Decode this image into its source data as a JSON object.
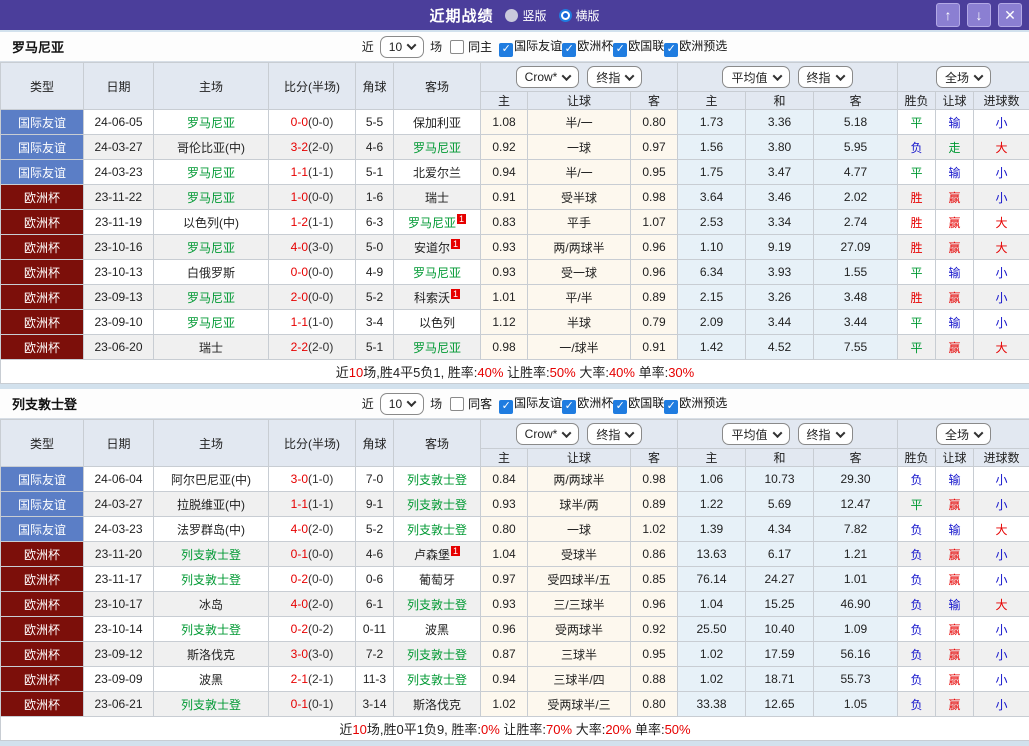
{
  "titlebar": {
    "title": "近期战绩",
    "radios": [
      {
        "label": "竖版",
        "selected": false
      },
      {
        "label": "横版",
        "selected": true
      }
    ],
    "buttons": {
      "up": "↑",
      "down": "↓",
      "close": "✕"
    }
  },
  "table_header": {
    "left_columns": [
      "类型",
      "日期",
      "主场",
      "比分(半场)",
      "角球",
      "客场"
    ],
    "odds_group": {
      "dropdowns": [
        "Crow*",
        "终指"
      ],
      "sub": [
        "主",
        "让球",
        "客"
      ]
    },
    "avg_group": {
      "dropdowns": [
        "平均值",
        "终指"
      ],
      "sub": [
        "主",
        "和",
        "客"
      ]
    },
    "result_group": {
      "dropdowns": [
        "全场"
      ],
      "sub": [
        "胜负",
        "让球",
        "进球数"
      ]
    }
  },
  "result_colors": {
    "胜": "#e60000",
    "平": "#009933",
    "负": "#1414cc",
    "赢": "#e60000",
    "走": "#009933",
    "输": "#1414cc",
    "大": "#e60000",
    "小": "#1414cc"
  },
  "type_colors": {
    "国际友谊": "blue",
    "欧洲杯": "maroon"
  },
  "sections": [
    {
      "team": "罗马尼亚",
      "filter": {
        "near_label": "近",
        "matches_value": "10",
        "unit_label": "场",
        "same_checkbox": {
          "label": "同主",
          "checked": false
        },
        "league_checkboxes": [
          {
            "label": "国际友谊",
            "checked": true
          },
          {
            "label": "欧洲杯",
            "checked": true
          },
          {
            "label": "欧国联",
            "checked": true
          },
          {
            "label": "欧洲预选",
            "checked": true
          }
        ]
      },
      "rows": [
        {
          "type": "国际友谊",
          "date": "24-06-05",
          "home": "罗马尼亚",
          "home_green": true,
          "home_mark": "",
          "score": "0-0",
          "half": "(0-0)",
          "corner": "5-5",
          "away": "保加利亚",
          "away_green": false,
          "away_mark": "",
          "odds": [
            "1.08",
            "半/一",
            "0.80"
          ],
          "avg": [
            "1.73",
            "3.36",
            "5.18"
          ],
          "result": [
            "平",
            "输",
            "小"
          ]
        },
        {
          "type": "国际友谊",
          "date": "24-03-27",
          "home": "哥伦比亚(中)",
          "home_green": false,
          "home_mark": "",
          "score": "3-2",
          "half": "(2-0)",
          "corner": "4-6",
          "away": "罗马尼亚",
          "away_green": true,
          "away_mark": "",
          "odds": [
            "0.92",
            "一球",
            "0.97"
          ],
          "avg": [
            "1.56",
            "3.80",
            "5.95"
          ],
          "result": [
            "负",
            "走",
            "大"
          ]
        },
        {
          "type": "国际友谊",
          "date": "24-03-23",
          "home": "罗马尼亚",
          "home_green": true,
          "home_mark": "",
          "score": "1-1",
          "half": "(1-1)",
          "corner": "5-1",
          "away": "北爱尔兰",
          "away_green": false,
          "away_mark": "",
          "odds": [
            "0.94",
            "半/一",
            "0.95"
          ],
          "avg": [
            "1.75",
            "3.47",
            "4.77"
          ],
          "result": [
            "平",
            "输",
            "小"
          ]
        },
        {
          "type": "欧洲杯",
          "date": "23-11-22",
          "home": "罗马尼亚",
          "home_green": true,
          "home_mark": "",
          "score": "1-0",
          "half": "(0-0)",
          "corner": "1-6",
          "away": "瑞士",
          "away_green": false,
          "away_mark": "",
          "odds": [
            "0.91",
            "受半球",
            "0.98"
          ],
          "avg": [
            "3.64",
            "3.46",
            "2.02"
          ],
          "result": [
            "胜",
            "赢",
            "小"
          ]
        },
        {
          "type": "欧洲杯",
          "date": "23-11-19",
          "home": "以色列(中)",
          "home_green": false,
          "home_mark": "",
          "score": "1-2",
          "half": "(1-1)",
          "corner": "6-3",
          "away": "罗马尼亚",
          "away_green": true,
          "away_mark": "1",
          "odds": [
            "0.83",
            "平手",
            "1.07"
          ],
          "avg": [
            "2.53",
            "3.34",
            "2.74"
          ],
          "result": [
            "胜",
            "赢",
            "大"
          ]
        },
        {
          "type": "欧洲杯",
          "date": "23-10-16",
          "home": "罗马尼亚",
          "home_green": true,
          "home_mark": "",
          "score": "4-0",
          "half": "(3-0)",
          "corner": "5-0",
          "away": "安道尔",
          "away_green": false,
          "away_mark": "1",
          "odds": [
            "0.93",
            "两/两球半",
            "0.96"
          ],
          "avg": [
            "1.10",
            "9.19",
            "27.09"
          ],
          "result": [
            "胜",
            "赢",
            "大"
          ]
        },
        {
          "type": "欧洲杯",
          "date": "23-10-13",
          "home": "白俄罗斯",
          "home_green": false,
          "home_mark": "",
          "score": "0-0",
          "half": "(0-0)",
          "corner": "4-9",
          "away": "罗马尼亚",
          "away_green": true,
          "away_mark": "",
          "odds": [
            "0.93",
            "受一球",
            "0.96"
          ],
          "avg": [
            "6.34",
            "3.93",
            "1.55"
          ],
          "result": [
            "平",
            "输",
            "小"
          ]
        },
        {
          "type": "欧洲杯",
          "date": "23-09-13",
          "home": "罗马尼亚",
          "home_green": true,
          "home_mark": "",
          "score": "2-0",
          "half": "(0-0)",
          "corner": "5-2",
          "away": "科索沃",
          "away_green": false,
          "away_mark": "1",
          "odds": [
            "1.01",
            "平/半",
            "0.89"
          ],
          "avg": [
            "2.15",
            "3.26",
            "3.48"
          ],
          "result": [
            "胜",
            "赢",
            "小"
          ]
        },
        {
          "type": "欧洲杯",
          "date": "23-09-10",
          "home": "罗马尼亚",
          "home_green": true,
          "home_mark": "",
          "score": "1-1",
          "half": "(1-0)",
          "corner": "3-4",
          "away": "以色列",
          "away_green": false,
          "away_mark": "",
          "odds": [
            "1.12",
            "半球",
            "0.79"
          ],
          "avg": [
            "2.09",
            "3.44",
            "3.44"
          ],
          "result": [
            "平",
            "输",
            "小"
          ]
        },
        {
          "type": "欧洲杯",
          "date": "23-06-20",
          "home": "瑞士",
          "home_green": false,
          "home_mark": "",
          "score": "2-2",
          "half": "(2-0)",
          "corner": "5-1",
          "away": "罗马尼亚",
          "away_green": true,
          "away_mark": "",
          "odds": [
            "0.98",
            "一/球半",
            "0.91"
          ],
          "avg": [
            "1.42",
            "4.52",
            "7.55"
          ],
          "result": [
            "平",
            "赢",
            "大"
          ]
        }
      ],
      "summary": [
        {
          "t": "近"
        },
        {
          "t": "10",
          "red": true
        },
        {
          "t": "场,胜4平5负1, 胜率:"
        },
        {
          "t": "40%",
          "red": true
        },
        {
          "t": " 让胜率:"
        },
        {
          "t": "50%",
          "red": true
        },
        {
          "t": " 大率:"
        },
        {
          "t": "40%",
          "red": true
        },
        {
          "t": " 单率:"
        },
        {
          "t": "30%",
          "red": true
        }
      ]
    },
    {
      "team": "列支敦士登",
      "filter": {
        "near_label": "近",
        "matches_value": "10",
        "unit_label": "场",
        "same_checkbox": {
          "label": "同客",
          "checked": false
        },
        "league_checkboxes": [
          {
            "label": "国际友谊",
            "checked": true
          },
          {
            "label": "欧洲杯",
            "checked": true
          },
          {
            "label": "欧国联",
            "checked": true
          },
          {
            "label": "欧洲预选",
            "checked": true
          }
        ]
      },
      "rows": [
        {
          "type": "国际友谊",
          "date": "24-06-04",
          "home": "阿尔巴尼亚(中)",
          "home_green": false,
          "home_mark": "",
          "score": "3-0",
          "half": "(1-0)",
          "corner": "7-0",
          "away": "列支敦士登",
          "away_green": true,
          "away_mark": "",
          "odds": [
            "0.84",
            "两/两球半",
            "0.98"
          ],
          "avg": [
            "1.06",
            "10.73",
            "29.30"
          ],
          "result": [
            "负",
            "输",
            "小"
          ]
        },
        {
          "type": "国际友谊",
          "date": "24-03-27",
          "home": "拉脱维亚(中)",
          "home_green": false,
          "home_mark": "",
          "score": "1-1",
          "half": "(1-1)",
          "corner": "9-1",
          "away": "列支敦士登",
          "away_green": true,
          "away_mark": "",
          "odds": [
            "0.93",
            "球半/两",
            "0.89"
          ],
          "avg": [
            "1.22",
            "5.69",
            "12.47"
          ],
          "result": [
            "平",
            "赢",
            "小"
          ]
        },
        {
          "type": "国际友谊",
          "date": "24-03-23",
          "home": "法罗群岛(中)",
          "home_green": false,
          "home_mark": "",
          "score": "4-0",
          "half": "(2-0)",
          "corner": "5-2",
          "away": "列支敦士登",
          "away_green": true,
          "away_mark": "",
          "odds": [
            "0.80",
            "一球",
            "1.02"
          ],
          "avg": [
            "1.39",
            "4.34",
            "7.82"
          ],
          "result": [
            "负",
            "输",
            "大"
          ]
        },
        {
          "type": "欧洲杯",
          "date": "23-11-20",
          "home": "列支敦士登",
          "home_green": true,
          "home_mark": "",
          "score": "0-1",
          "half": "(0-0)",
          "corner": "4-6",
          "away": "卢森堡",
          "away_green": false,
          "away_mark": "1",
          "odds": [
            "1.04",
            "受球半",
            "0.86"
          ],
          "avg": [
            "13.63",
            "6.17",
            "1.21"
          ],
          "result": [
            "负",
            "赢",
            "小"
          ]
        },
        {
          "type": "欧洲杯",
          "date": "23-11-17",
          "home": "列支敦士登",
          "home_green": true,
          "home_mark": "",
          "score": "0-2",
          "half": "(0-0)",
          "corner": "0-6",
          "away": "葡萄牙",
          "away_green": false,
          "away_mark": "",
          "odds": [
            "0.97",
            "受四球半/五",
            "0.85"
          ],
          "avg": [
            "76.14",
            "24.27",
            "1.01"
          ],
          "result": [
            "负",
            "赢",
            "小"
          ]
        },
        {
          "type": "欧洲杯",
          "date": "23-10-17",
          "home": "冰岛",
          "home_green": false,
          "home_mark": "",
          "score": "4-0",
          "half": "(2-0)",
          "corner": "6-1",
          "away": "列支敦士登",
          "away_green": true,
          "away_mark": "",
          "odds": [
            "0.93",
            "三/三球半",
            "0.96"
          ],
          "avg": [
            "1.04",
            "15.25",
            "46.90"
          ],
          "result": [
            "负",
            "输",
            "大"
          ]
        },
        {
          "type": "欧洲杯",
          "date": "23-10-14",
          "home": "列支敦士登",
          "home_green": true,
          "home_mark": "",
          "score": "0-2",
          "half": "(0-2)",
          "corner": "0-11",
          "away": "波黑",
          "away_green": false,
          "away_mark": "",
          "odds": [
            "0.96",
            "受两球半",
            "0.92"
          ],
          "avg": [
            "25.50",
            "10.40",
            "1.09"
          ],
          "result": [
            "负",
            "赢",
            "小"
          ]
        },
        {
          "type": "欧洲杯",
          "date": "23-09-12",
          "home": "斯洛伐克",
          "home_green": false,
          "home_mark": "",
          "score": "3-0",
          "half": "(3-0)",
          "corner": "7-2",
          "away": "列支敦士登",
          "away_green": true,
          "away_mark": "",
          "odds": [
            "0.87",
            "三球半",
            "0.95"
          ],
          "avg": [
            "1.02",
            "17.59",
            "56.16"
          ],
          "result": [
            "负",
            "赢",
            "小"
          ]
        },
        {
          "type": "欧洲杯",
          "date": "23-09-09",
          "home": "波黑",
          "home_green": false,
          "home_mark": "",
          "score": "2-1",
          "half": "(2-1)",
          "corner": "11-3",
          "away": "列支敦士登",
          "away_green": true,
          "away_mark": "",
          "odds": [
            "0.94",
            "三球半/四",
            "0.88"
          ],
          "avg": [
            "1.02",
            "18.71",
            "55.73"
          ],
          "result": [
            "负",
            "赢",
            "小"
          ]
        },
        {
          "type": "欧洲杯",
          "date": "23-06-21",
          "home": "列支敦士登",
          "home_green": true,
          "home_mark": "",
          "score": "0-1",
          "half": "(0-1)",
          "corner": "3-14",
          "away": "斯洛伐克",
          "away_green": false,
          "away_mark": "",
          "odds": [
            "1.02",
            "受两球半/三",
            "0.80"
          ],
          "avg": [
            "33.38",
            "12.65",
            "1.05"
          ],
          "result": [
            "负",
            "赢",
            "小"
          ]
        }
      ],
      "summary": [
        {
          "t": "近"
        },
        {
          "t": "10",
          "red": true
        },
        {
          "t": "场,胜0平1负9, 胜率:"
        },
        {
          "t": "0%",
          "red": true
        },
        {
          "t": " 让胜率:"
        },
        {
          "t": "70%",
          "red": true
        },
        {
          "t": " 大率:"
        },
        {
          "t": "20%",
          "red": true
        },
        {
          "t": " 单率:"
        },
        {
          "t": "50%",
          "red": true
        }
      ]
    }
  ]
}
